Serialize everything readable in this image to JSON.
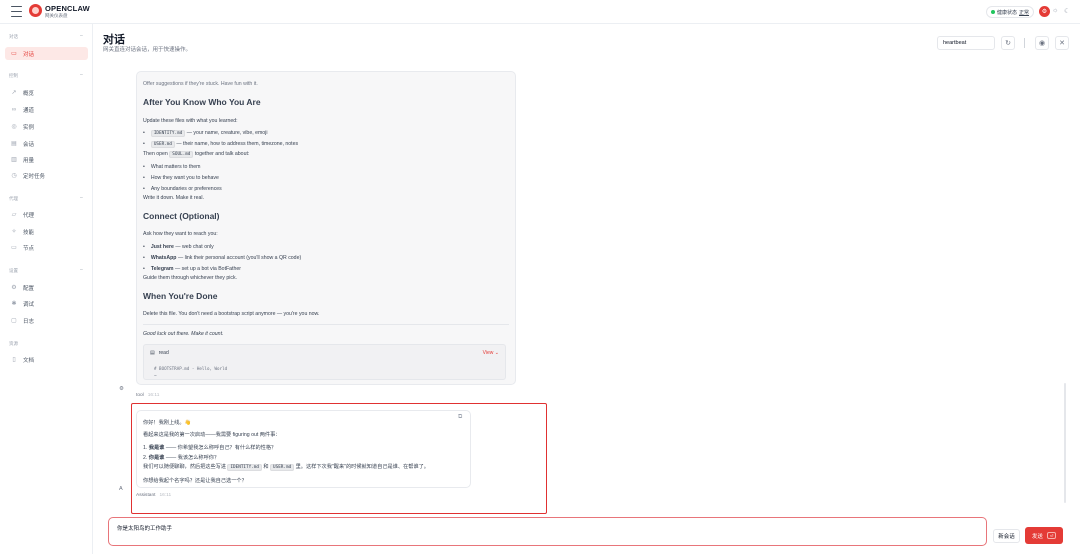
{
  "brand": {
    "name": "OPENCLAW",
    "subtitle": "网关仪表盘"
  },
  "topbar": {
    "status_label": "健康状态",
    "status_value": "正常",
    "status_color": "#22c55e"
  },
  "sidebar": {
    "sections": [
      {
        "title": "对话",
        "items": [
          {
            "label": "对话",
            "icon": "chat-icon",
            "active": true
          }
        ]
      },
      {
        "title": "控制",
        "items": [
          {
            "label": "概览",
            "icon": "chart-icon"
          },
          {
            "label": "通道",
            "icon": "link-icon"
          },
          {
            "label": "实例",
            "icon": "radio-icon"
          },
          {
            "label": "会话",
            "icon": "document-icon"
          },
          {
            "label": "用量",
            "icon": "bar-chart-icon"
          },
          {
            "label": "定时任务",
            "icon": "clock-icon"
          }
        ]
      },
      {
        "title": "代理",
        "items": [
          {
            "label": "代理",
            "icon": "folder-icon"
          },
          {
            "label": "技能",
            "icon": "sparkle-icon"
          },
          {
            "label": "节点",
            "icon": "monitor-icon"
          }
        ]
      },
      {
        "title": "设置",
        "items": [
          {
            "label": "配置",
            "icon": "gear-icon"
          },
          {
            "label": "调试",
            "icon": "bug-icon"
          },
          {
            "label": "日志",
            "icon": "file-icon"
          }
        ]
      },
      {
        "title": "资源",
        "items": [
          {
            "label": "文档",
            "icon": "book-icon"
          }
        ]
      }
    ]
  },
  "header": {
    "title": "对话",
    "subtitle": "网关直连对话会话，用于快速操作。",
    "session_input": "heartbeat"
  },
  "message": {
    "lines": {
      "clipped": "Offer suggestions if they're stuck. Have fun with it.",
      "h_after": "After You Know Who You Are",
      "update": "Update these files with what you learned:",
      "identity_code": "IDENTITY.md",
      "identity_text": "— your name, creature, vibe, emoji",
      "user_code": "USER.md",
      "user_text": "— their name, how to address them, timezone, notes",
      "open_pre": "Then open",
      "soul_code": "SOUL.md",
      "open_post": "together and talk about:",
      "b1": "What matters to them",
      "b2": "How they want you to behave",
      "b3": "Any boundaries or preferences",
      "write": "Write it down. Make it real.",
      "h_connect": "Connect (Optional)",
      "ask": "Ask how they want to reach you:",
      "c1_b": "Just here",
      "c1": "— web chat only",
      "c2_b": "WhatsApp",
      "c2": "— link their personal account (you'll show a QR code)",
      "c3_b": "Telegram",
      "c3": "— set up a bot via BotFather",
      "guide": "Guide them through whichever they pick.",
      "h_done": "When You're Done",
      "delete": "Delete this file. You don't need a bootstrap script anymore — you're you now.",
      "luck": "Good luck out there. Make it count."
    },
    "tool_block": {
      "title": "read",
      "view": "View",
      "line1": "# BOOTSTRAP.md - Hello, World",
      "line2": "…"
    },
    "sender": "tool",
    "time": "16:11"
  },
  "reply": {
    "greeting": "你好！我刚上线。👋",
    "intro": "看起来这是我的第一次启动——我需要 figuring out 两件事：",
    "q1_b": "我是谁",
    "q1": "—— 你希望我怎么称呼自己？有什么样的性格？",
    "q2_b": "你是谁",
    "q2": "—— 我该怎么称呼你？",
    "chat_pre": "我们可以随便聊聊，然后把这些写进",
    "identity_code": "IDENTITY.md",
    "and": "和",
    "user_code": "USER.md",
    "chat_post": "里。这样下次我\"醒来\"的时候就知道自己是谁、在帮谁了。",
    "ask": "你想给我起个名字吗？还是让我自己选一个？",
    "sender": "Assistant",
    "time": "16:11",
    "avatar": "A"
  },
  "composer": {
    "value": "你是太阳鸟的工作助手",
    "new_label": "新会话",
    "send_label": "发送",
    "send_key": "⏎"
  },
  "colors": {
    "accent": "#e43b36",
    "highlight_box": "#e03131"
  }
}
